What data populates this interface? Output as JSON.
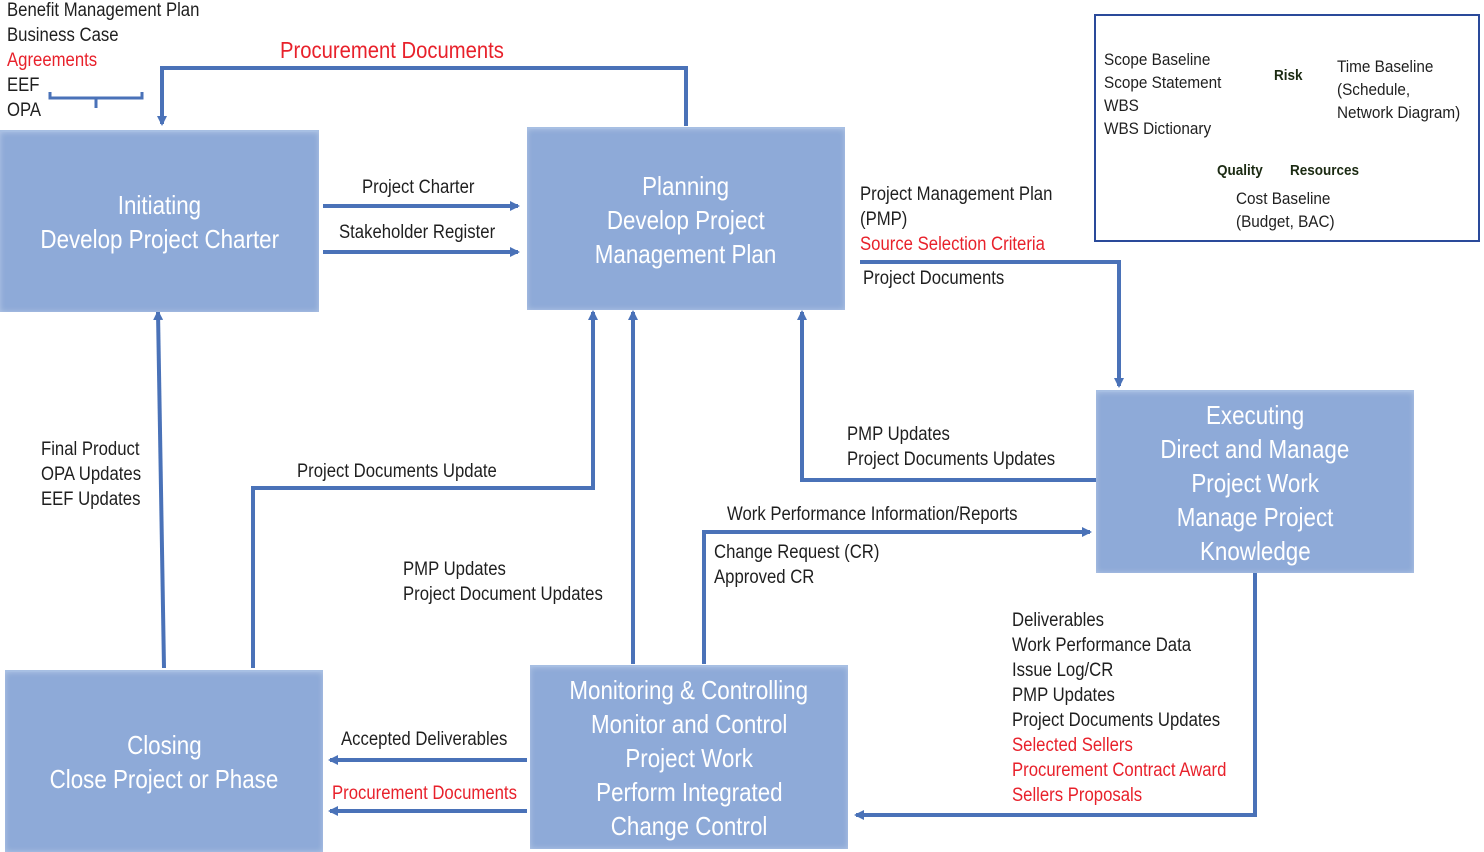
{
  "inputs_top_left": [
    {
      "text": "Benefit Management Plan",
      "color": "black"
    },
    {
      "text": "Business Case",
      "color": "black"
    },
    {
      "text": "Agreements",
      "color": "red"
    },
    {
      "text": "EEF",
      "color": "black"
    },
    {
      "text": "OPA",
      "color": "black"
    }
  ],
  "top_flow_label": "Procurement Documents",
  "boxes": {
    "initiating": [
      "Initiating",
      "Develop Project Charter"
    ],
    "planning": [
      "Planning",
      "Develop Project",
      "Management Plan"
    ],
    "executing": [
      "Executing",
      "Direct and Manage",
      "Project Work",
      "Manage Project",
      "Knowledge"
    ],
    "monitoring": [
      "Monitoring & Controlling",
      "Monitor and Control",
      "Project Work",
      "Perform Integrated",
      "Change Control"
    ],
    "closing": [
      "Closing",
      "Close Project or Phase"
    ]
  },
  "flows": {
    "initiating_to_planning": [
      "Project Charter",
      "Stakeholder Register"
    ],
    "planning_to_executing": [
      {
        "text": "Project Management Plan",
        "color": "black"
      },
      {
        "text": "(PMP)",
        "color": "black"
      },
      {
        "text": "Source Selection Criteria",
        "color": "red"
      }
    ],
    "planning_to_executing_below": "Project Documents",
    "executing_to_planning": [
      "PMP Updates",
      "Project Documents Updates"
    ],
    "monitoring_to_executing": "Work Performance Information/Reports",
    "monitoring_change": [
      "Change Request (CR)",
      "Approved CR"
    ],
    "executing_to_monitoring": [
      {
        "text": "Deliverables",
        "color": "black"
      },
      {
        "text": "Work Performance Data",
        "color": "black"
      },
      {
        "text": "Issue Log/CR",
        "color": "black"
      },
      {
        "text": "PMP Updates",
        "color": "black"
      },
      {
        "text": "Project Documents Updates",
        "color": "black"
      },
      {
        "text": "Selected Sellers",
        "color": "red"
      },
      {
        "text": "Procurement Contract Award",
        "color": "red"
      },
      {
        "text": "Sellers Proposals",
        "color": "red"
      }
    ],
    "closing_to_initiating": [
      "Final Product",
      "OPA Updates",
      "EEF Updates"
    ],
    "closing_to_planning": "Project Documents Update",
    "monitoring_to_planning": [
      "PMP Updates",
      "Project Document Updates"
    ],
    "monitoring_to_closing": [
      {
        "text": "Accepted Deliverables",
        "color": "black"
      },
      {
        "text": "Procurement Documents",
        "color": "red"
      }
    ]
  },
  "inset": {
    "scope": [
      {
        "text": "Scope Baseline",
        "color": "black"
      },
      {
        "text": "Scope Statement",
        "color": "red"
      },
      {
        "text": "WBS",
        "color": "red"
      },
      {
        "text": "WBS Dictionary",
        "color": "red"
      }
    ],
    "time": [
      {
        "text": "Time Baseline",
        "color": "black"
      },
      {
        "text": "(Schedule,",
        "color": "red"
      },
      {
        "text": "Network Diagram)",
        "color": "red"
      }
    ],
    "cost": [
      {
        "text": "Cost Baseline",
        "color": "black"
      },
      {
        "text": "(Budget, BAC)",
        "color": "red"
      }
    ],
    "triangle": {
      "top": "Risk",
      "left": "Quality",
      "right": "Resources"
    }
  },
  "colors": {
    "box_fill": "#8eaad8",
    "arrow": "#4a72b8",
    "red_text": "#e8212b",
    "triangle_green": "#27b24a",
    "inset_border": "#2a4a9a"
  }
}
